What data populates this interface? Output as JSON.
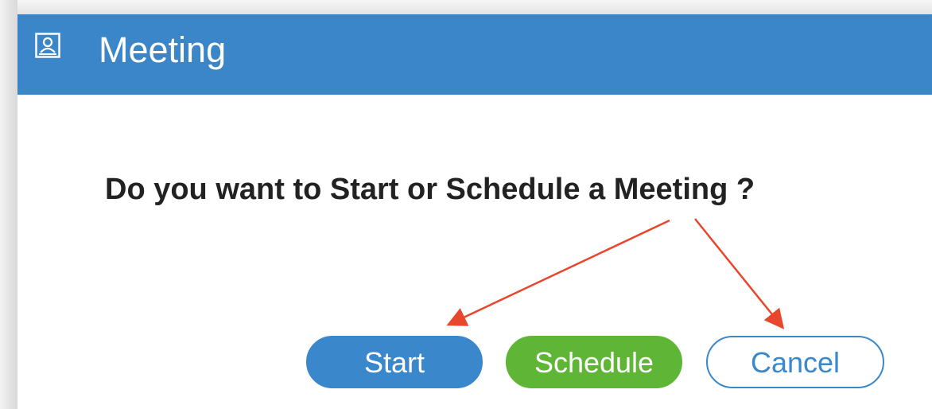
{
  "dialog": {
    "title": "Meeting",
    "title_icon": "presenter-screen-icon",
    "question": "Do you want to Start or Schedule a Meeting ?",
    "buttons": {
      "start": "Start",
      "schedule": "Schedule",
      "cancel": "Cancel"
    }
  },
  "colors": {
    "titlebar": "#3b86c8",
    "primary": "#3a87cc",
    "schedule": "#5fb535",
    "annotation_arrow": "#e8462d"
  }
}
